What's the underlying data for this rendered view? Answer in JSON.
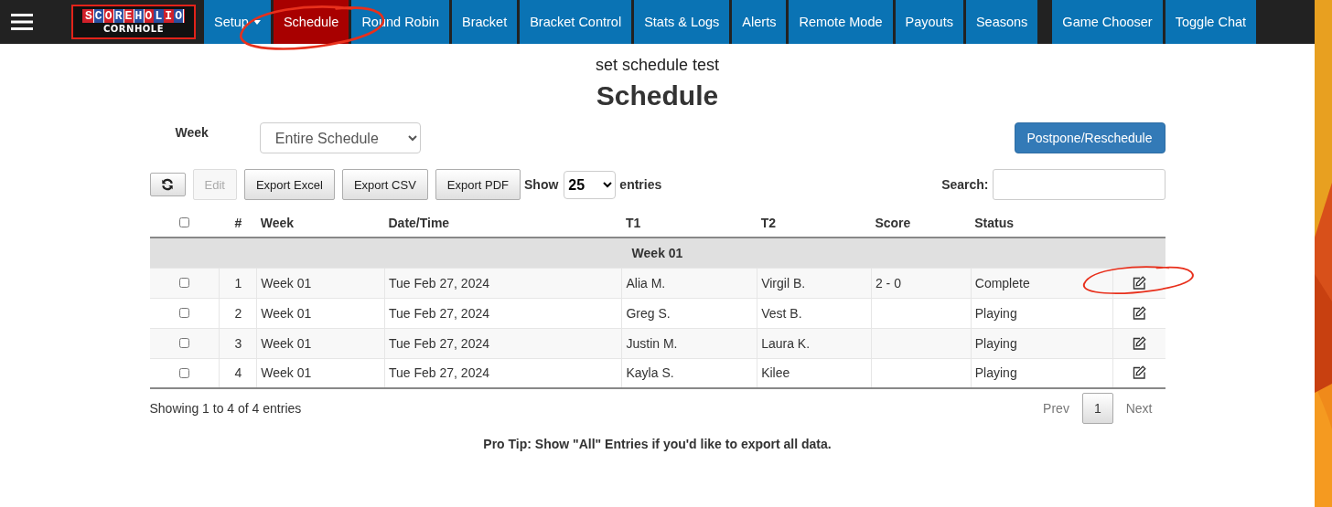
{
  "logo": {
    "top": "SCOREHOLIO",
    "bottom": "CORNHOLE"
  },
  "nav": [
    {
      "label": "Setup",
      "dropdown": true,
      "selected": false,
      "circled": false
    },
    {
      "label": "Schedule",
      "dropdown": false,
      "selected": true,
      "circled": true
    },
    {
      "label": "Round Robin",
      "dropdown": false,
      "selected": false,
      "circled": false
    },
    {
      "label": "Bracket",
      "dropdown": false,
      "selected": false,
      "circled": false
    },
    {
      "label": "Bracket Control",
      "dropdown": false,
      "selected": false,
      "circled": false
    },
    {
      "label": "Stats & Logs",
      "dropdown": false,
      "selected": false,
      "circled": false
    },
    {
      "label": "Alerts",
      "dropdown": false,
      "selected": false,
      "circled": false
    },
    {
      "label": "Remote Mode",
      "dropdown": false,
      "selected": false,
      "circled": false
    },
    {
      "label": "Payouts",
      "dropdown": false,
      "selected": false,
      "circled": false
    },
    {
      "label": "Seasons",
      "dropdown": false,
      "selected": false,
      "circled": false
    }
  ],
  "nav_right": [
    {
      "label": "Game Chooser"
    },
    {
      "label": "Toggle Chat"
    }
  ],
  "subtitle": "set schedule test",
  "title": "Schedule",
  "week_filter": {
    "label": "Week",
    "value": "Entire Schedule"
  },
  "postpone_button": "Postpone/Reschedule",
  "toolbar": {
    "edit": {
      "label": "Edit",
      "disabled": true
    },
    "exports": [
      "Export Excel",
      "Export CSV",
      "Export PDF"
    ],
    "show_label": "Show",
    "page_size": "25",
    "entries_label": "entries",
    "search_label": "Search:"
  },
  "table": {
    "columns": [
      "#",
      "Week",
      "Date/Time",
      "T1",
      "T2",
      "Score",
      "Status"
    ],
    "header_checked": false,
    "group": "Week 01",
    "rows": [
      {
        "checked": false,
        "cells": [
          "1",
          "Week 01",
          "Tue Feb 27, 2024",
          "Alia M.",
          "Virgil B.",
          "2 - 0",
          "Complete"
        ],
        "circled": true
      },
      {
        "checked": false,
        "cells": [
          "2",
          "Week 01",
          "Tue Feb 27, 2024",
          "Greg S.",
          "Vest B.",
          "",
          "Playing"
        ],
        "circled": false
      },
      {
        "checked": false,
        "cells": [
          "3",
          "Week 01",
          "Tue Feb 27, 2024",
          "Justin M.",
          "Laura K.",
          "",
          "Playing"
        ],
        "circled": false
      },
      {
        "checked": false,
        "cells": [
          "4",
          "Week 01",
          "Tue Feb 27, 2024",
          "Kayla S.",
          "Kilee",
          "",
          "Playing"
        ],
        "circled": false
      }
    ]
  },
  "info": "Showing 1 to 4 of 4 entries",
  "pagination": {
    "prev": "Prev",
    "pages": [
      {
        "label": "1",
        "selected": true
      }
    ],
    "next": "Next"
  },
  "tip": "Pro Tip: Show \"All\" Entries if you'd like to export all data."
}
